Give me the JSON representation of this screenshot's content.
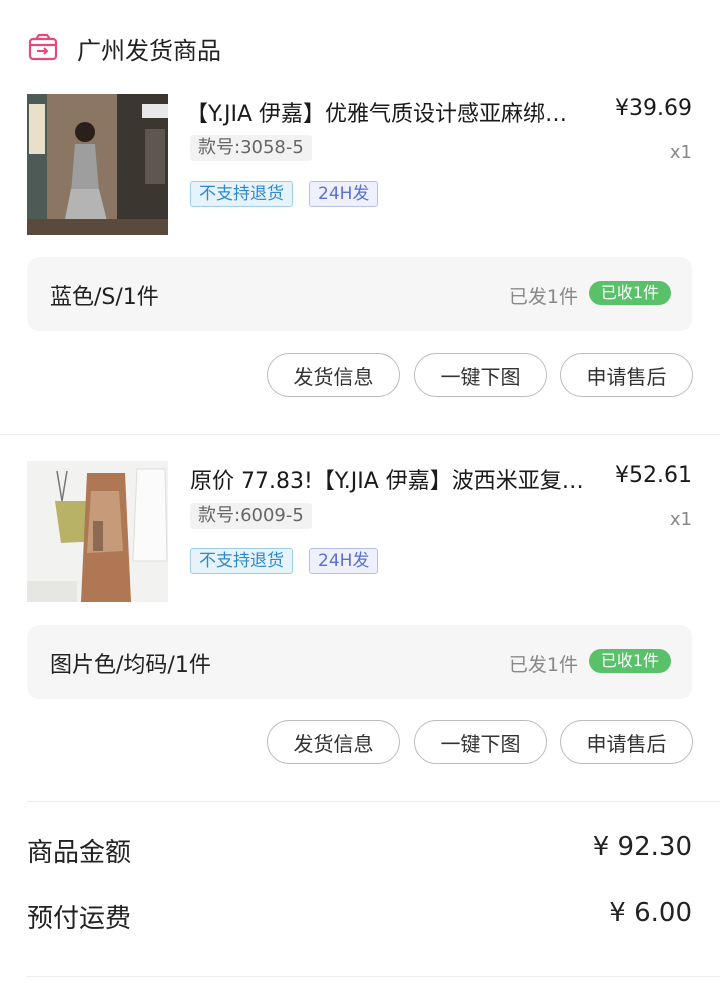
{
  "header": {
    "title": "广州发货商品",
    "icon": "package-send-icon"
  },
  "items": [
    {
      "name": "【Y.JIA 伊嘉】优雅气质设计感亚麻绑…",
      "price": "¥39.69",
      "qty": "x1",
      "sku": "款号:3058-5",
      "tags": [
        "不支持退货",
        "24H发"
      ],
      "variant": "蓝色/S/1件",
      "shipped": "已发1件",
      "received": "已收1件",
      "buttons": [
        "发货信息",
        "一键下图",
        "申请售后"
      ]
    },
    {
      "name": "原价 77.83!【Y.JIA 伊嘉】波西米亚复…",
      "price": "¥52.61",
      "qty": "x1",
      "sku": "款号:6009-5",
      "tags": [
        "不支持退货",
        "24H发"
      ],
      "variant": "图片色/均码/1件",
      "shipped": "已发1件",
      "received": "已收1件",
      "buttons": [
        "发货信息",
        "一键下图",
        "申请售后"
      ]
    }
  ],
  "summary": {
    "goods_label": "商品金额",
    "goods_value": "¥ 92.30",
    "freight_label": "预付运费",
    "freight_value": "¥ 6.00"
  },
  "colors": {
    "accent_pink": "#e64a7a",
    "received_green": "#5ac16b",
    "tag_blue": "#2d8acd"
  }
}
